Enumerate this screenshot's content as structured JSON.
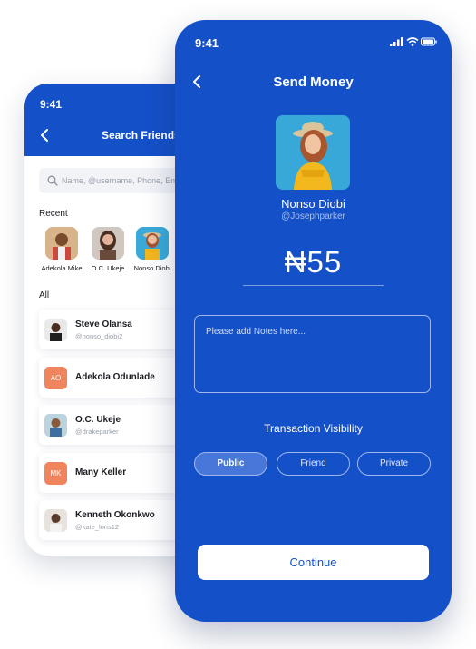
{
  "colors": {
    "brand_blue": "#1450c8",
    "avatar_orange": "#f0845d"
  },
  "back_screen": {
    "status_time": "9:41",
    "title": "Search Friends",
    "search_placeholder": "Name, @username, Phone, Email",
    "recent_label": "Recent",
    "recent": [
      {
        "name": "Adekola Mike"
      },
      {
        "name": "O.C. Ukeje"
      },
      {
        "name": "Nonso Diobi"
      }
    ],
    "all_label": "All",
    "contacts": [
      {
        "name": "Steve Olansa",
        "handle": "@nonso_diobi2"
      },
      {
        "name": "Adekola Odunlade",
        "initials": "AO"
      },
      {
        "name": "O.C. Ukeje",
        "handle": "@drakeparker"
      },
      {
        "name": "Many Keller",
        "initials": "MK"
      },
      {
        "name": "Kenneth Okonkwo",
        "handle": "@kate_loris12"
      }
    ]
  },
  "front_screen": {
    "status_time": "9:41",
    "title": "Send Money",
    "recipient": {
      "name": "Nonso Diobi",
      "handle": "@Josephparker"
    },
    "amount": "₦55",
    "notes_placeholder": "Please add Notes here...",
    "visibility_label": "Transaction Visibility",
    "visibility_options": [
      "Public",
      "Friend",
      "Private"
    ],
    "visibility_selected": "Public",
    "continue_label": "Continue"
  }
}
